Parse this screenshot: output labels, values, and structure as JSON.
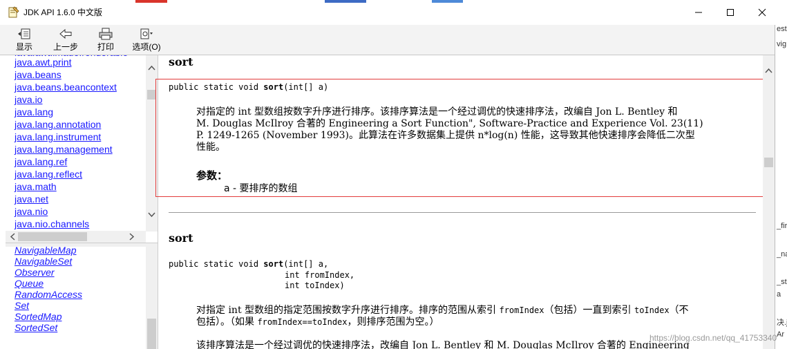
{
  "window": {
    "title": "JDK API 1.6.0 中文版"
  },
  "toolbar": {
    "show_label": "显示",
    "back_label": "上一步",
    "print_label": "打印",
    "options_label": "选项(O)"
  },
  "package_list": {
    "items": [
      "java.awt.print",
      "java.beans",
      "java.beans.beancontext",
      "java.io",
      "java.lang",
      "java.lang.annotation",
      "java.lang.instrument",
      "java.lang.management",
      "java.lang.ref",
      "java.lang.reflect",
      "java.math",
      "java.net",
      "java.nio",
      "java.nio.channels"
    ]
  },
  "class_list": {
    "items": [
      "NavigableMap",
      "NavigableSet",
      "Observer",
      "Queue",
      "RandomAccess",
      "Set",
      "SortedMap",
      "SortedSet"
    ]
  },
  "content": {
    "method1": {
      "heading": "sort",
      "sig_prefix": "public static void ",
      "sig_name": "sort",
      "sig_params": "(int[] a)",
      "desc_line1": "对指定的 int 型数组按数字升序进行排序。该排序算法是一个经过调优的快速排序法，改编自 Jon L. Bentley 和",
      "desc_line2": "M. Douglas McIlroy 合著的 Engineering a Sort Function\", Software-Practice and Experience Vol. 23(11)",
      "desc_line3": "P. 1249-1265 (November 1993)。此算法在许多数据集上提供 n*log(n) 性能，这导致其他快速排序会降低二次型",
      "desc_line4": "性能。",
      "params_label": "参数：",
      "param_text": "a - 要排序的数组"
    },
    "method2": {
      "heading": "sort",
      "sig_prefix": "public static void ",
      "sig_name": "sort",
      "sig_line1_rest": "(int[] a,",
      "sig_line2": "int fromIndex,",
      "sig_line3": "int toIndex)",
      "desc_a1": "对指定 int 型数组的指定范围按数字升序进行排序。排序的范围从索引 ",
      "desc_a_code1": "fromIndex",
      "desc_a2": "（包括）一直到索引 ",
      "desc_a_code2": "toIndex",
      "desc_a3": "（不",
      "desc_b1": "包括）。（如果 ",
      "desc_b_code": "fromIndex==toIndex",
      "desc_b2": "，则排序范围为空。）",
      "desc_c": "该排序算法是一个经过调优的快速排序法，改编自 Jon L. Bentley 和 M. Douglas McIlroy 合著的 Engineering"
    }
  },
  "background_window": {
    "fragments": [
      "est",
      "vig",
      "_fir",
      "_na",
      "_st",
      "a",
      "决.ja",
      "Ar"
    ]
  },
  "watermark": "https://blog.csdn.net/qq_41753340",
  "colors": {
    "link": "#1a1aff",
    "highlight_border": "#e23b3b"
  }
}
